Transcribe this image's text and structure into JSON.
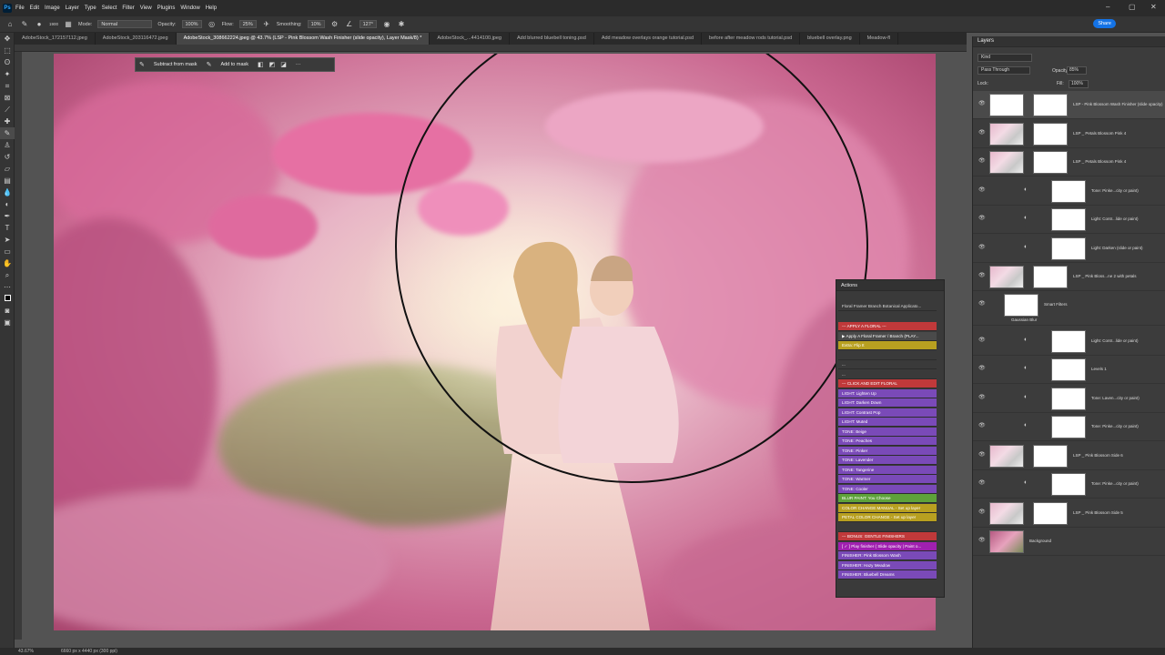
{
  "menu": {
    "logo": "Ps",
    "items": [
      "File",
      "Edit",
      "Image",
      "Layer",
      "Type",
      "Select",
      "Filter",
      "View",
      "Plugins",
      "Window",
      "Help"
    ]
  },
  "options": {
    "brush_size": "1900",
    "mode_label": "Mode:",
    "mode_value": "Normal",
    "opacity_label": "Opacity:",
    "opacity_value": "100%",
    "flow_label": "Flow:",
    "flow_value": "25%",
    "smoothing_label": "Smoothing:",
    "smoothing_value": "10%",
    "angle_value": "127°",
    "share_label": "Share"
  },
  "tabs": [
    {
      "label": "AdobeStock_172157112.jpeg",
      "active": false
    },
    {
      "label": "AdobeStock_203116472.jpeg",
      "active": false
    },
    {
      "label": "AdobeStock_308662224.jpeg @ 43.7% (LSP - Pink Blossom Wash Finisher (slide opacity), Layer Mask/8) *",
      "active": true
    },
    {
      "label": "AdobeStock_...4414100.jpeg",
      "active": false
    },
    {
      "label": "Add blurred bluebell toning.psd",
      "active": false
    },
    {
      "label": "Add meadow overlays orange tutorial.psd",
      "active": false
    },
    {
      "label": "before after meadow rods tutorial.psd",
      "active": false
    },
    {
      "label": "bluebell overlay.png",
      "active": false
    },
    {
      "label": "Meadow-fl",
      "active": false
    }
  ],
  "mask_bar": {
    "subtract_label": "Subtract from mask",
    "add_label": "Add to mask",
    "more": "···"
  },
  "status": {
    "zoom": "43.67%",
    "doc_size": "6660 px x 4440 px (300 ppi)"
  },
  "layers_panel": {
    "title": "Layers",
    "kind_label": "Kind",
    "blend_mode": "Pass Through",
    "opacity_label": "Opacity:",
    "opacity_value": "85%",
    "lock_label": "Lock:",
    "fill_label": "Fill:",
    "fill_value": "100%",
    "layers": [
      {
        "name": "LSP - Pink Blossom Wash Finisher (slide opacity)",
        "thumb": "mask",
        "selected": true
      },
      {
        "name": "LSP _ Petals Blossom Pink 4",
        "thumb": "pink"
      },
      {
        "name": "LSP _ Petals Blossom Pink 4",
        "thumb": "pink"
      },
      {
        "name": "Tone: Pinke...city or paint)",
        "thumb": "adj"
      },
      {
        "name": "Light: Contr...lide or paint)",
        "thumb": "adj"
      },
      {
        "name": "Light: Darken (slide or paint)",
        "thumb": "adj"
      },
      {
        "name": "LSP _ Pink Bloss...ne 2 with petals",
        "thumb": "pink"
      },
      {
        "name": "Smart Filters",
        "thumb": "mask"
      },
      {
        "name": "Light: Contr...lide or paint)",
        "thumb": "adj"
      },
      {
        "name": "Levels 1",
        "thumb": "adj"
      },
      {
        "name": "Tone: Laven...city or paint)",
        "thumb": "adj"
      },
      {
        "name": "Tone: Pinke...city or paint)",
        "thumb": "adj"
      },
      {
        "name": "LSP _ Pink Blossom Side 6",
        "thumb": "pink"
      },
      {
        "name": "Tone: Pinke...city or paint)",
        "thumb": "adj"
      },
      {
        "name": "LSP _ Pink Blossom Side 5",
        "thumb": "pink"
      },
      {
        "name": "Background",
        "thumb": "photo"
      }
    ],
    "sub_filter": "Gaussian Blur"
  },
  "actions_panel": {
    "title": "Actions",
    "set_name": "Floral Framer Branch Botanical Applicato...",
    "rows": [
      {
        "label": "--- APPLY A FLORAL ---",
        "color": "#c0393a"
      },
      {
        "label": "▶ Apply A Floral Framer / Branch (PLAY...",
        "color": "#4a4a4a"
      },
      {
        "label": "Extra: Flip It",
        "color": "#b8a020"
      },
      {
        "label": "",
        "color": "#3a3a3a"
      },
      {
        "label": "...",
        "color": "#3a3a3a"
      },
      {
        "label": "...",
        "color": "#3a3a3a"
      },
      {
        "label": "--- CLICK AND EDIT FLORAL",
        "color": "#c0393a"
      },
      {
        "label": "LIGHT: Lighten Up",
        "color": "#7a4ab8"
      },
      {
        "label": "LIGHT: Darken Down",
        "color": "#7a4ab8"
      },
      {
        "label": "LIGHT: Contrast Pop",
        "color": "#7a4ab8"
      },
      {
        "label": "LIGHT: Muted",
        "color": "#7a4ab8"
      },
      {
        "label": "TONE: Beige",
        "color": "#7a4ab8"
      },
      {
        "label": "TONE: Peaches",
        "color": "#7a4ab8"
      },
      {
        "label": "TONE: Pinker",
        "color": "#7a4ab8"
      },
      {
        "label": "TONE: Lavender",
        "color": "#7a4ab8"
      },
      {
        "label": "TONE: Tangerine",
        "color": "#7a4ab8"
      },
      {
        "label": "TONE: Warmer",
        "color": "#7a4ab8"
      },
      {
        "label": "TONE: Cooler",
        "color": "#7a4ab8"
      },
      {
        "label": "BLUR PAINT: You Choose",
        "color": "#5ea23a"
      },
      {
        "label": "COLOR CHANGE MANUAL - Set up layer",
        "color": "#b8a020"
      },
      {
        "label": "PETAL COLOR CHANGE - Set up layer",
        "color": "#b8a020"
      },
      {
        "label": "",
        "color": "#3a3a3a"
      },
      {
        "label": "--- BONUS: GENTLE FINISHERS",
        "color": "#c0393a"
      },
      {
        "label": "[ ✓ ] Play finisher ( Slide opacity | Paint o...",
        "color": "#a020b0"
      },
      {
        "label": "FINISHER: Pink Blossom Wash",
        "color": "#7a4ab8"
      },
      {
        "label": "FINISHER: Hazy Meadow",
        "color": "#7a4ab8"
      },
      {
        "label": "FINISHER: Bluebell Dreams",
        "color": "#7a4ab8"
      }
    ]
  }
}
